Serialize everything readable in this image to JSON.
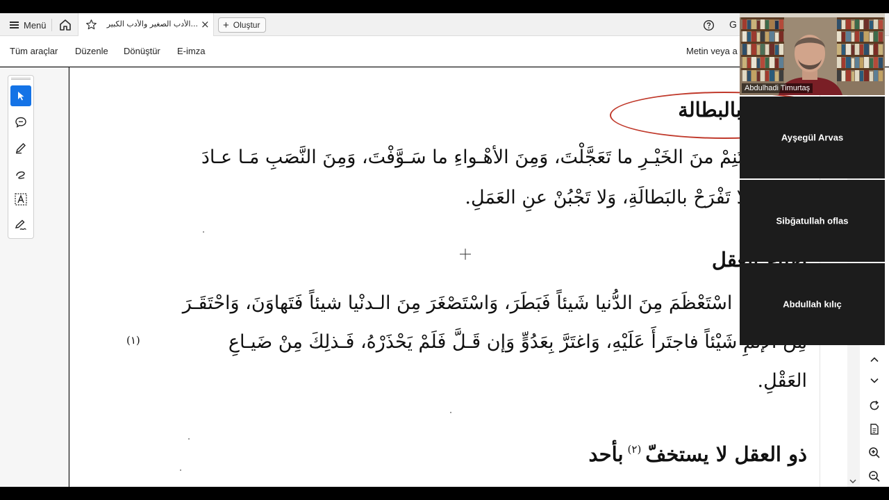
{
  "browser": {
    "menu_label": "Menü",
    "tab_title": "الأدب الصغير والأدب الكبير...",
    "tab_close": "×",
    "create_label": "Oluştur",
    "profile_letter": "G"
  },
  "toolbar": {
    "items": [
      "Tüm araçlar",
      "Düzenle",
      "Dönüştür",
      "E-imza"
    ],
    "search_text": "Metin veya a"
  },
  "side_tools": [
    "select-icon",
    "comment-icon",
    "pen-icon",
    "draw-icon",
    "text-recognition-icon",
    "sign-icon"
  ],
  "document": {
    "heading1": "لا تفرح بالبطالة",
    "para1_line1": "اغْتَنِمْ منَ الخَيْـرِ ما تَعَجَّلْتَ، وَمِنَ الأهْـواءِ ما سَـوَّفْتَ، وَمِنَ النَّصَبِ مَـا عـادَ",
    "para1_line2": "عَلَيْكَ. وَلا تَفْرَحْ بالبَطالَةِ، وَلا تَجْبُنْ عنِ العَمَلِ.",
    "heading2": "ضياع العقل",
    "para2_line1": "مَنِ اسْتَعْظَمَ مِنَ الدُّنيا شَيئاً فَبَطَرَ، وَاسْتَصْغَرَ مِنَ الـدنْيا شيئاً فَتَهاوَنَ، وَاحْتَقَـرَ",
    "para2_line2": "مِنَ الإثْمِ شَيْئاً فاجتَرأَ عَلَيْهِ، وَاغتَرَّ بِعَدُوٍّ وَإن قَـلَّ فَلَمْ يَحْذَرْهُ، فَـذلِكَ مِنْ ضَيـاعِ",
    "para2_footnote": "(١)",
    "para2_line3": "العَقْلِ.",
    "heading3": "ذو العقل لا يستخفّ",
    "heading3_footnote": "(٢)",
    "heading3_end": "بأحد"
  },
  "video_tiles": {
    "camera_name": "Abdulhadi Timurtaş",
    "participants": [
      "Ayşegül Arvas",
      "Sibğatullah oflas",
      "Abdullah kılıç"
    ]
  },
  "colors": {
    "accent": "#1473e6",
    "annotation_red": "#c0392b",
    "tile_bg": "#1c1c1c"
  }
}
